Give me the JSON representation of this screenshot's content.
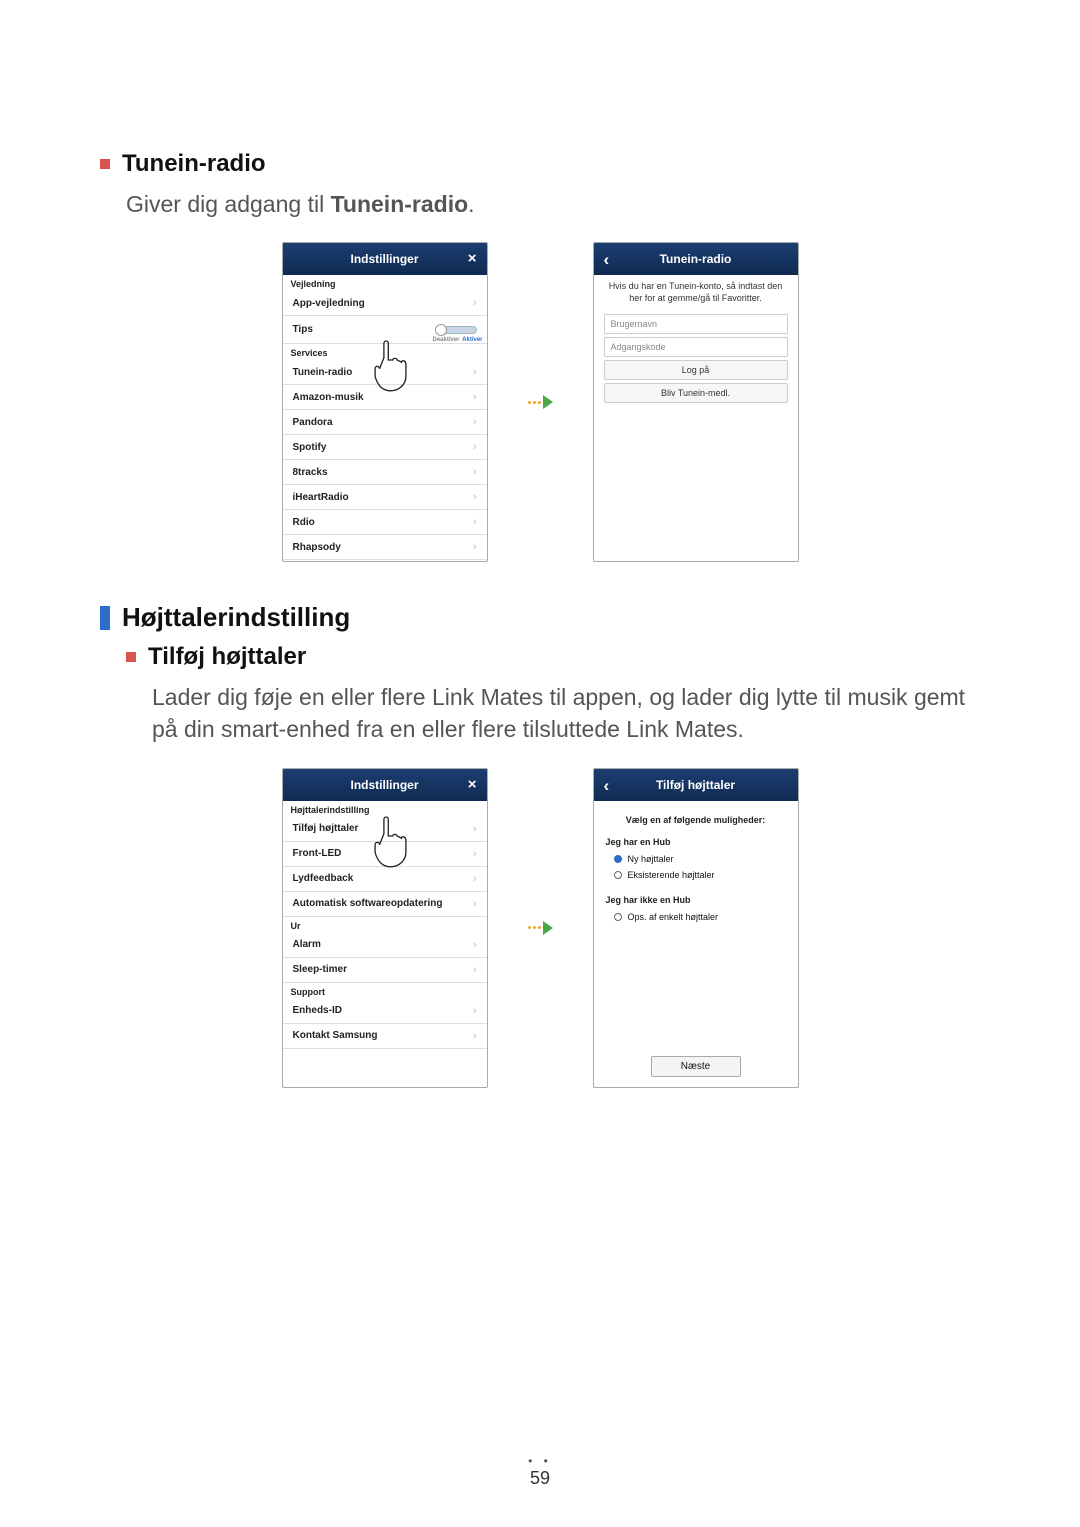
{
  "page_number": "59",
  "section1": {
    "title": "Tunein-radio",
    "desc_prefix": "Giver dig adgang til ",
    "desc_bold": "Tunein-radio",
    "desc_suffix": ".",
    "left": {
      "title": "Indstillinger",
      "group1": "Vejledning",
      "item_app": "App-vejledning",
      "item_tips": "Tips",
      "toggle_off": "Deaktiver",
      "toggle_on": "Aktiver",
      "group2": "Services",
      "services": [
        "Tunein-radio",
        "Amazon-musik",
        "Pandora",
        "Spotify",
        "8tracks",
        "iHeartRadio",
        "Rdio",
        "Rhapsody"
      ]
    },
    "right": {
      "title": "Tunein-radio",
      "hint": "Hvis du har en Tunein-konto, så indtast den her for at gemme/gå til Favoritter.",
      "field_user": "Brugernavn",
      "field_pass": "Adgangskode",
      "btn_login": "Log på",
      "btn_signup": "Bliv Tunein-medl."
    }
  },
  "section2": {
    "title": "Højttalerindstilling",
    "sub": {
      "title": "Tilføj højttaler",
      "desc": "Lader dig føje en eller flere Link Mates til appen, og lader dig lytte til musik gemt på din smart-enhed fra en eller flere tilsluttede Link Mates.",
      "left": {
        "title": "Indstillinger",
        "group1": "Højttalerindstilling",
        "items1": [
          "Tilføj højttaler",
          "Front-LED",
          "Lydfeedback",
          "Automatisk softwareopdatering"
        ],
        "group2": "Ur",
        "items2": [
          "Alarm",
          "Sleep-timer"
        ],
        "group3": "Support",
        "items3": [
          "Enheds-ID",
          "Kontakt Samsung"
        ]
      },
      "right": {
        "title": "Tilføj højttaler",
        "header": "Vælg en af følgende muligheder:",
        "g1": "Jeg har en Hub",
        "g1_opt1": "Ny højttaler",
        "g1_opt2": "Eksisterende højttaler",
        "g2": "Jeg har ikke en Hub",
        "g2_opt1": "Ops. af enkelt højttaler",
        "btn_next": "Næste"
      }
    }
  }
}
